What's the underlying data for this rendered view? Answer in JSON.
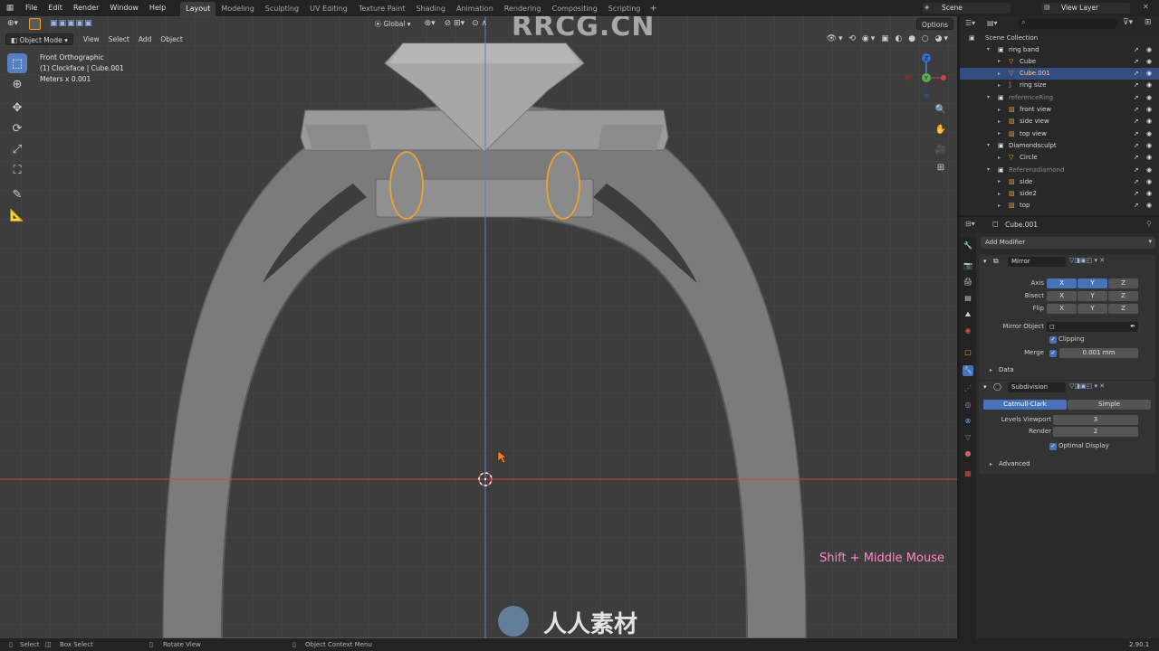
{
  "app": {
    "menus": [
      "File",
      "Edit",
      "Render",
      "Window",
      "Help"
    ],
    "workspaces": [
      "Layout",
      "Modeling",
      "Sculpting",
      "UV Editing",
      "Texture Paint",
      "Shading",
      "Animation",
      "Rendering",
      "Compositing",
      "Scripting"
    ],
    "active_workspace": "Layout",
    "scene_label": "Scene",
    "view_layer_label": "View Layer"
  },
  "viewport": {
    "mode": "Object Mode",
    "menu": [
      "View",
      "Select",
      "Add",
      "Object"
    ],
    "transform_orientation": "Global",
    "options_label": "Options",
    "view_name": "Front Orthographic",
    "object_info": "(1) Clockface | Cube.001",
    "units_info": "Meters x 0.001",
    "shortcut_overlay": "Shift + Middle Mouse",
    "watermark_top": "RRCG.CN",
    "watermark_bottom": "人人素材",
    "gizmo_z": "Z",
    "gizmo_y": "Y"
  },
  "outliner": {
    "root": "Scene Collection",
    "items": [
      {
        "label": "ring band",
        "indent": 1,
        "kind": "collection"
      },
      {
        "label": "Cube",
        "indent": 2,
        "kind": "mesh"
      },
      {
        "label": "Cube.001",
        "indent": 2,
        "kind": "mesh",
        "selected": true
      },
      {
        "label": "ring size",
        "indent": 2,
        "kind": "curve"
      },
      {
        "label": "referenceRing",
        "indent": 1,
        "kind": "collection",
        "dim": true
      },
      {
        "label": "front view",
        "indent": 2,
        "kind": "image"
      },
      {
        "label": "side view",
        "indent": 2,
        "kind": "image"
      },
      {
        "label": "top view",
        "indent": 2,
        "kind": "image"
      },
      {
        "label": "Diamondsculpt",
        "indent": 1,
        "kind": "collection"
      },
      {
        "label": "Circle",
        "indent": 2,
        "kind": "mesh"
      },
      {
        "label": "Referenzdiamond",
        "indent": 1,
        "kind": "collection",
        "dim": true
      },
      {
        "label": "side",
        "indent": 2,
        "kind": "image"
      },
      {
        "label": "side2",
        "indent": 2,
        "kind": "image"
      },
      {
        "label": "top",
        "indent": 2,
        "kind": "image"
      }
    ]
  },
  "properties": {
    "object_name": "Cube.001",
    "add_modifier": "Add Modifier",
    "mirror": {
      "name": "Mirror",
      "axis_label": "Axis",
      "bisect_label": "Bisect",
      "flip_label": "Flip",
      "xyz": [
        "X",
        "Y",
        "Z"
      ],
      "mirror_object_label": "Mirror Object",
      "clipping_label": "Clipping",
      "merge_label": "Merge",
      "merge_value": "0.001 mm",
      "data_label": "Data"
    },
    "subdivision": {
      "name": "Subdivision",
      "catmull": "Catmull-Clark",
      "simple": "Simple",
      "levels_label": "Levels Viewport",
      "levels_value": "3",
      "render_label": "Render",
      "render_value": "2",
      "optimal_label": "Optimal Display",
      "advanced_label": "Advanced"
    }
  },
  "statusbar": {
    "select": "Select",
    "box_select": "Box Select",
    "rotate_view": "Rotate View",
    "context_menu": "Object Context Menu",
    "version": "2.90.1"
  },
  "colors": {
    "accent": "#5680c2",
    "selection_outline": "#f0a030",
    "x_axis": "#c84848",
    "y_axis": "#5080d0",
    "overlay_text": "#ff88cc"
  }
}
